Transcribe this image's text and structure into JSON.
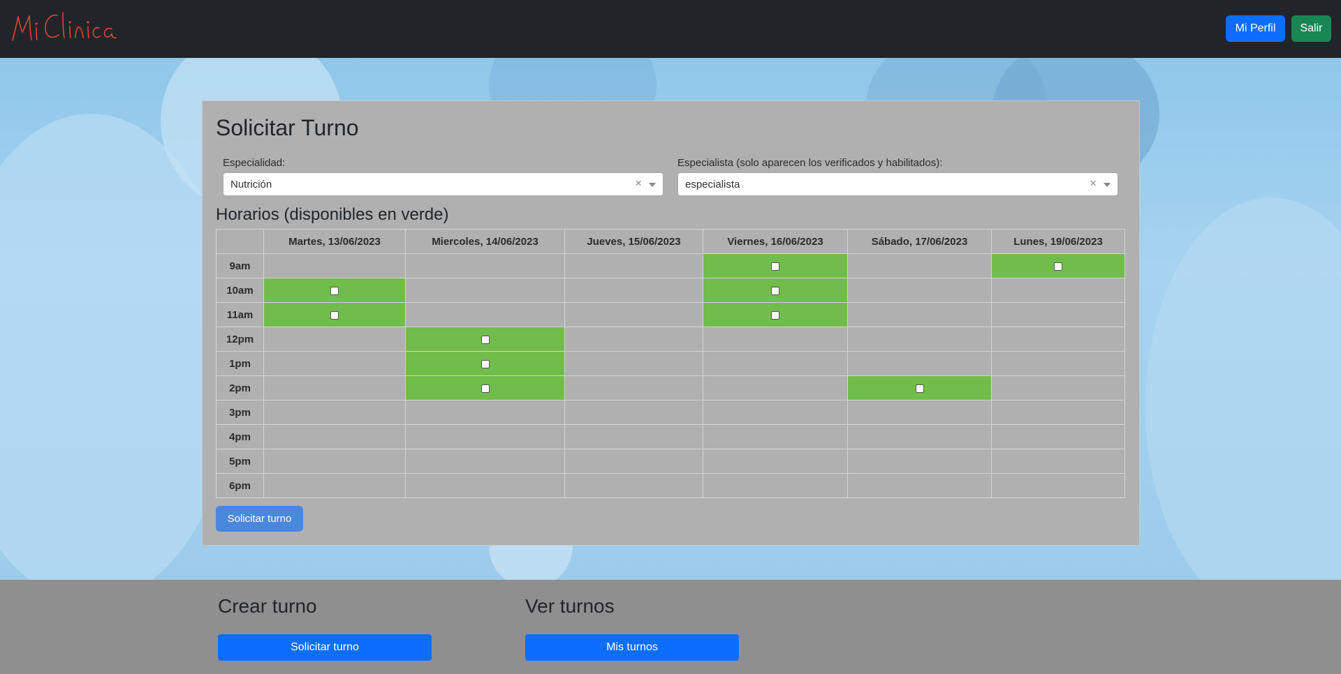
{
  "navbar": {
    "logo_text": "Mi Clínica",
    "profile_label": "Mi Perfil",
    "logout_label": "Salir",
    "colors": {
      "bg": "#212529",
      "profile": "#0d6efd",
      "logout": "#198754",
      "logo": "#e0443a"
    }
  },
  "form": {
    "title": "Solicitar Turno",
    "specialty_label": "Especialidad:",
    "specialty_value": "Nutrición",
    "specialist_label": "Especialista (solo aparecen los verificados y habilitados):",
    "specialist_value": "especialista",
    "clear_icon": "×",
    "schedule_title": "Horarios (disponibles en verde)",
    "submit_label": "Solicitar turno"
  },
  "schedule": {
    "days": [
      "Martes, 13/06/2023",
      "Miercoles, 14/06/2023",
      "Jueves, 15/06/2023",
      "Viernes, 16/06/2023",
      "Sábado, 17/06/2023",
      "Lunes, 19/06/2023"
    ],
    "hours": [
      "9am",
      "10am",
      "11am",
      "12pm",
      "1pm",
      "2pm",
      "3pm",
      "4pm",
      "5pm",
      "6pm"
    ],
    "available": [
      [
        false,
        false,
        false,
        true,
        false,
        true
      ],
      [
        true,
        false,
        false,
        true,
        false,
        false
      ],
      [
        true,
        false,
        false,
        true,
        false,
        false
      ],
      [
        false,
        true,
        false,
        false,
        false,
        false
      ],
      [
        false,
        true,
        false,
        false,
        false,
        false
      ],
      [
        false,
        true,
        false,
        false,
        true,
        false
      ],
      [
        false,
        false,
        false,
        false,
        false,
        false
      ],
      [
        false,
        false,
        false,
        false,
        false,
        false
      ],
      [
        false,
        false,
        false,
        false,
        false,
        false
      ],
      [
        false,
        false,
        false,
        false,
        false,
        false
      ]
    ],
    "available_color": "#70bd4b"
  },
  "footer": {
    "create_title": "Crear turno",
    "create_button": "Solicitar turno",
    "view_title": "Ver turnos",
    "view_button": "Mis turnos"
  }
}
